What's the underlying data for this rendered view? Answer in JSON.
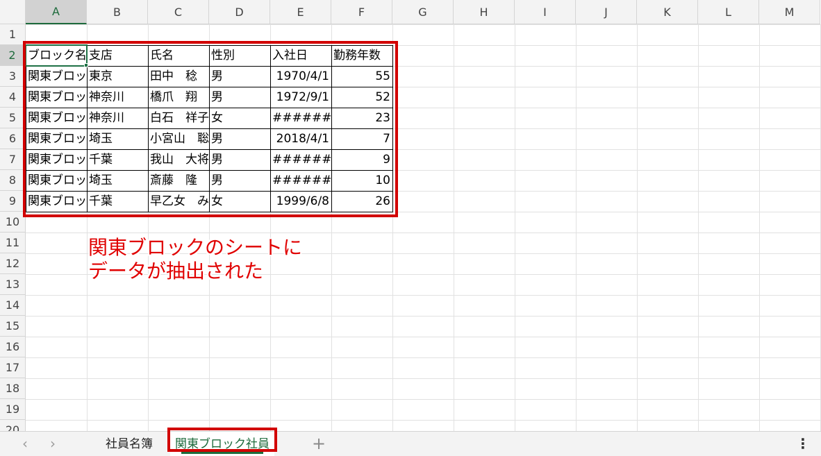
{
  "columns": [
    "A",
    "B",
    "C",
    "D",
    "E",
    "F",
    "G",
    "H",
    "I",
    "J",
    "K",
    "L",
    "M"
  ],
  "rows": [
    "1",
    "2",
    "3",
    "4",
    "5",
    "6",
    "7",
    "8",
    "9",
    "10",
    "11",
    "12",
    "13",
    "14",
    "15",
    "16",
    "17",
    "18",
    "19",
    "20"
  ],
  "table": {
    "headers": [
      "ブロック名",
      "支店",
      "氏名",
      "性別",
      "入社日",
      "勤務年数"
    ],
    "data_rows": [
      [
        "関東ブロック",
        "東京",
        "田中　稔",
        "男",
        "1970/4/1",
        "55"
      ],
      [
        "関東ブロック",
        "神奈川",
        "橋爪　翔",
        "男",
        "1972/9/1",
        "52"
      ],
      [
        "関東ブロック",
        "神奈川",
        "白石　祥子",
        "女",
        "########",
        "23"
      ],
      [
        "関東ブロック",
        "埼玉",
        "小宮山　聡",
        "男",
        "2018/4/1",
        "7"
      ],
      [
        "関東ブロック",
        "千葉",
        "我山　大将",
        "男",
        "########",
        "9"
      ],
      [
        "関東ブロック",
        "埼玉",
        "斎藤　隆",
        "男",
        "########",
        "10"
      ],
      [
        "関東ブロック",
        "千葉",
        "早乙女　み",
        "女",
        "1999/6/8",
        "26"
      ]
    ]
  },
  "annotation": {
    "line1": "関東ブロックのシートに",
    "line2": "データが抽出された"
  },
  "tabs": {
    "prev_icon": "‹",
    "next_icon": "›",
    "sheets": [
      {
        "label": "社員名簿",
        "active": false
      },
      {
        "label": "関東ブロック社員",
        "active": true
      }
    ],
    "add_icon": "+",
    "more_icon": "⋮"
  },
  "colors": {
    "accent_green": "#1e6b3c",
    "annotation_red": "#e00000"
  }
}
